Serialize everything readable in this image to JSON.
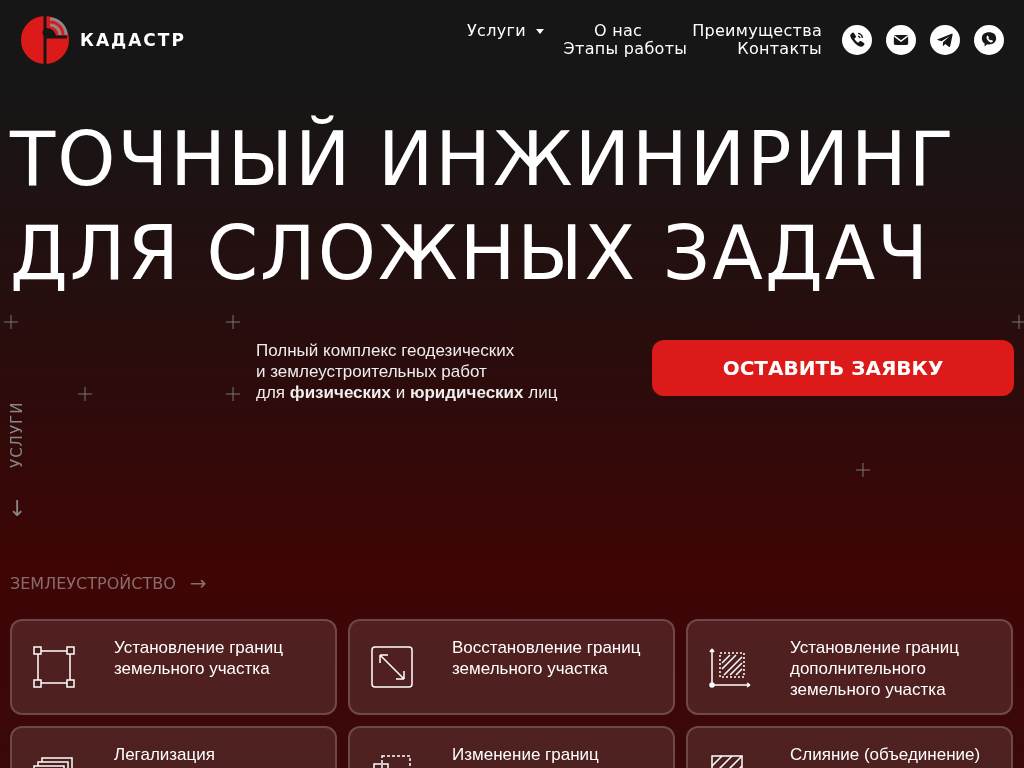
{
  "header": {
    "logo_text": "КАДАСТР",
    "nav": [
      {
        "label": "Услуги",
        "has_dropdown": true
      },
      {
        "label": "О нас",
        "has_dropdown": false
      },
      {
        "label": "Преимущества",
        "has_dropdown": false
      },
      {
        "label": "Этапы работы",
        "has_dropdown": false
      },
      {
        "label": "Контакты",
        "has_dropdown": false
      }
    ],
    "contacts": [
      {
        "kind": "phone"
      },
      {
        "kind": "mail"
      },
      {
        "kind": "telegram"
      },
      {
        "kind": "viber"
      }
    ]
  },
  "hero": {
    "title_lines": [
      "ТОЧНЫЙ ИНЖИНИРИНГ",
      "ДЛЯ СЛОЖНЫХ ЗАДАЧ"
    ],
    "subtitle": "Полный комплекс геодезических\nи землеустроительных работ\nдля **физических** и **юридических** лиц",
    "cta": "ОСТАВИТЬ ЗАЯВКУ",
    "side_label": "УСЛУГИ",
    "side_arrow": "↓"
  },
  "services": {
    "section_label": "ЗЕМЛЕУСТРОЙСТВО",
    "section_arrow": "→",
    "cards": [
      {
        "kind": "corners",
        "title": "Установление границ земельного участка"
      },
      {
        "kind": "diagonal",
        "title": "Восстановление границ земельного участка"
      },
      {
        "kind": "hatched",
        "title": "Установление границ дополнительного земельного участка"
      },
      {
        "kind": "layers",
        "title": "Легализация"
      },
      {
        "kind": "dashed",
        "title": "Изменение границ"
      },
      {
        "kind": "hatched-solid",
        "title": "Слияние (объединение)"
      }
    ]
  }
}
